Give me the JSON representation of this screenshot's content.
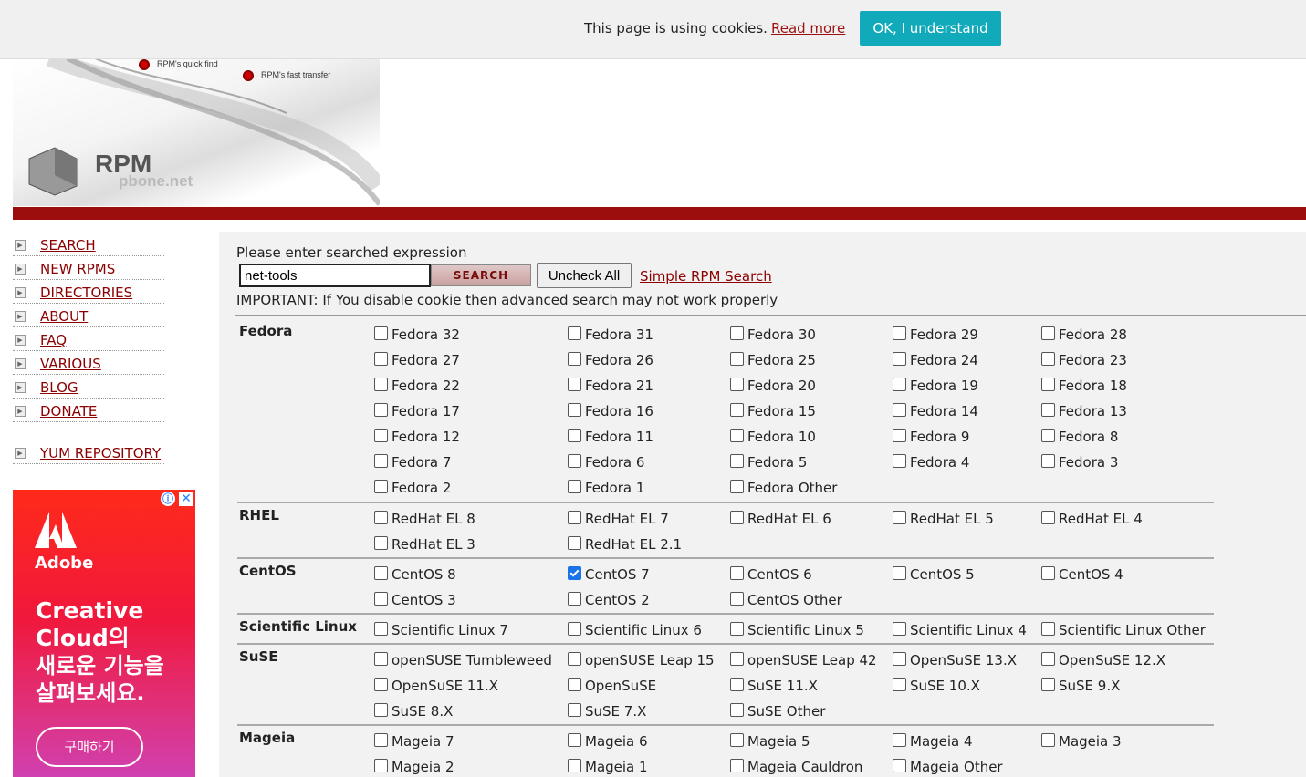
{
  "cookie": {
    "message": "This page is using cookies.",
    "link": "Read more",
    "button": "OK, I understand"
  },
  "logo": {
    "brand": "RPM",
    "domain": "pbone.net",
    "label1": "RPM's quick find",
    "label2": "RPM's fast transfer"
  },
  "nav": {
    "items": [
      "SEARCH",
      "NEW RPMS",
      "DIRECTORIES",
      "ABOUT",
      "FAQ",
      "VARIOUS",
      "BLOG",
      "DONATE"
    ],
    "yum": "YUM REPOSITORY"
  },
  "ad": {
    "brand": "Adobe",
    "headline1": "Creative Cloud의",
    "headline2": "새로운 기능을 살펴보세요.",
    "button": "구매하기",
    "info": "ⓘ",
    "close": "✕"
  },
  "search": {
    "prompt": "Please enter searched expression",
    "value": "net-tools",
    "search_label": "SEARCH",
    "uncheck_label": "Uncheck All",
    "simple_label": "Simple RPM Search",
    "important": "IMPORTANT: If You disable cookie then advanced search may not work properly"
  },
  "groups": [
    {
      "name": "Fedora",
      "items": [
        {
          "label": "Fedora 32"
        },
        {
          "label": "Fedora 31"
        },
        {
          "label": "Fedora 30"
        },
        {
          "label": "Fedora 29"
        },
        {
          "label": "Fedora 28"
        },
        {
          "label": "Fedora 27"
        },
        {
          "label": "Fedora 26"
        },
        {
          "label": "Fedora 25"
        },
        {
          "label": "Fedora 24"
        },
        {
          "label": "Fedora 23"
        },
        {
          "label": "Fedora 22"
        },
        {
          "label": "Fedora 21"
        },
        {
          "label": "Fedora 20"
        },
        {
          "label": "Fedora 19"
        },
        {
          "label": "Fedora 18"
        },
        {
          "label": "Fedora 17"
        },
        {
          "label": "Fedora 16"
        },
        {
          "label": "Fedora 15"
        },
        {
          "label": "Fedora 14"
        },
        {
          "label": "Fedora 13"
        },
        {
          "label": "Fedora 12"
        },
        {
          "label": "Fedora 11"
        },
        {
          "label": "Fedora 10"
        },
        {
          "label": "Fedora 9"
        },
        {
          "label": "Fedora 8"
        },
        {
          "label": "Fedora 7"
        },
        {
          "label": "Fedora 6"
        },
        {
          "label": "Fedora 5"
        },
        {
          "label": "Fedora 4"
        },
        {
          "label": "Fedora 3"
        },
        {
          "label": "Fedora 2"
        },
        {
          "label": "Fedora 1"
        },
        {
          "label": "Fedora Other"
        }
      ]
    },
    {
      "name": "RHEL",
      "items": [
        {
          "label": "RedHat EL 8"
        },
        {
          "label": "RedHat EL 7"
        },
        {
          "label": "RedHat EL 6"
        },
        {
          "label": "RedHat EL 5"
        },
        {
          "label": "RedHat EL 4"
        },
        {
          "label": "RedHat EL 3"
        },
        {
          "label": "RedHat EL 2.1"
        }
      ]
    },
    {
      "name": "CentOS",
      "items": [
        {
          "label": "CentOS 8"
        },
        {
          "label": "CentOS 7",
          "checked": true
        },
        {
          "label": "CentOS 6"
        },
        {
          "label": "CentOS 5"
        },
        {
          "label": "CentOS 4"
        },
        {
          "label": "CentOS 3"
        },
        {
          "label": "CentOS 2"
        },
        {
          "label": "CentOS Other"
        }
      ]
    },
    {
      "name": "Scientific Linux",
      "items": [
        {
          "label": "Scientific Linux 7"
        },
        {
          "label": "Scientific Linux 6"
        },
        {
          "label": "Scientific Linux 5"
        },
        {
          "label": "Scientific Linux 4"
        },
        {
          "label": "Scientific Linux Other"
        }
      ]
    },
    {
      "name": "SuSE",
      "items": [
        {
          "label": "openSUSE Tumbleweed"
        },
        {
          "label": "openSUSE Leap 15"
        },
        {
          "label": "openSUSE Leap 42"
        },
        {
          "label": "OpenSuSE 13.X"
        },
        {
          "label": "OpenSuSE 12.X"
        },
        {
          "label": "OpenSuSE 11.X"
        },
        {
          "label": "OpenSuSE"
        },
        {
          "label": "SuSE 11.X"
        },
        {
          "label": "SuSE 10.X"
        },
        {
          "label": "SuSE 9.X"
        },
        {
          "label": "SuSE 8.X"
        },
        {
          "label": "SuSE 7.X"
        },
        {
          "label": "SuSE Other"
        }
      ]
    },
    {
      "name": "Mageia",
      "items": [
        {
          "label": "Mageia 7"
        },
        {
          "label": "Mageia 6"
        },
        {
          "label": "Mageia 5"
        },
        {
          "label": "Mageia 4"
        },
        {
          "label": "Mageia 3"
        },
        {
          "label": "Mageia 2"
        },
        {
          "label": "Mageia 1"
        },
        {
          "label": "Mageia Cauldron"
        },
        {
          "label": "Mageia Other"
        }
      ]
    }
  ],
  "colors": {
    "accent": "#9c0d0d",
    "cookie_button": "#10aabb",
    "link": "#8b0000",
    "checkbox": "#1a73e8"
  }
}
